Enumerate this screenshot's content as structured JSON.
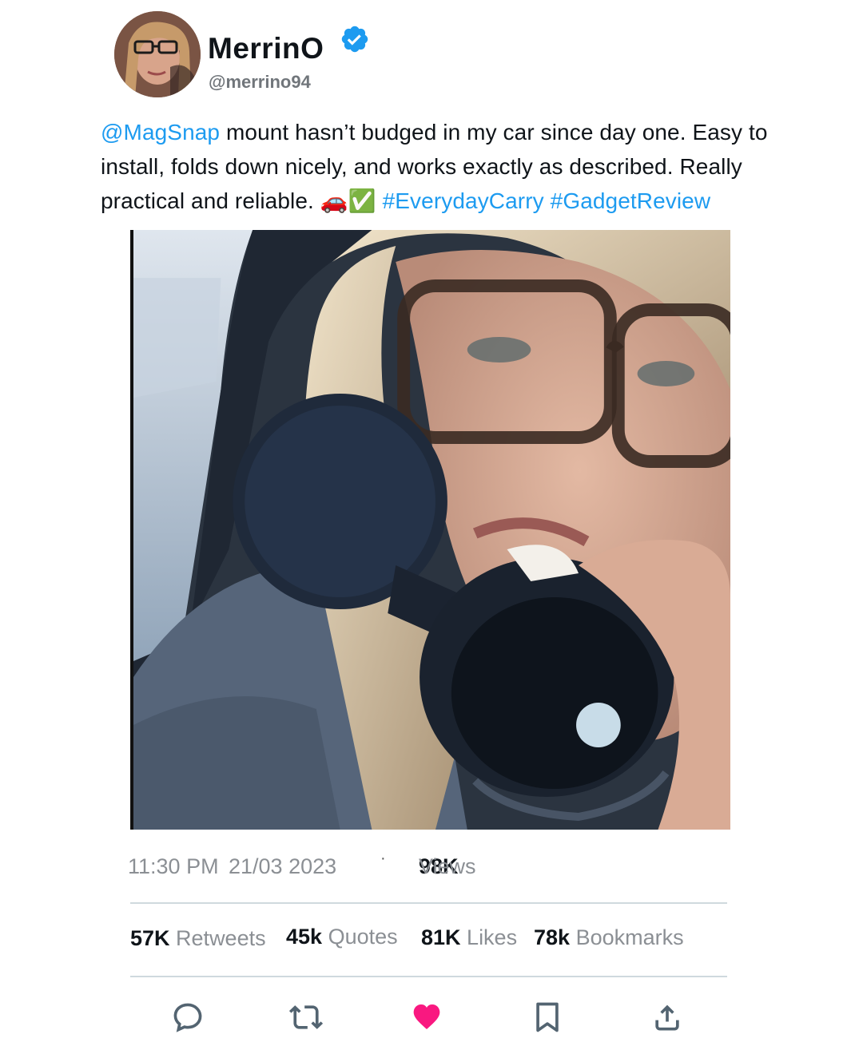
{
  "author": {
    "display_name": "MerrinO",
    "handle": "@merrino94",
    "verified": true
  },
  "tweet": {
    "mention": "@MagSnap",
    "text_main": " mount hasn’t budged in my car since day one. Easy to install, folds down nicely, and works exactly as described. Really practical and reliable. ",
    "emojis": "🚗✅",
    "hashtag_1": "#EverydayCarry",
    "hashtag_2": "#GadgetReview"
  },
  "meta": {
    "time": "11:30 PM",
    "date": "21/03 2023",
    "separator": "·",
    "views_count": "98K",
    "views_label": "Views"
  },
  "stats": {
    "retweets_count": "57K",
    "retweets_label": "Retweets",
    "quotes_count": "45k",
    "quotes_label": "Quotes",
    "likes_count": "81K",
    "likes_label": "Likes",
    "bookmarks_count": "78k",
    "bookmarks_label": "Bookmarks"
  },
  "actions": {
    "reply_icon": "speech-bubble",
    "retweet_icon": "retweet-arrows",
    "like_icon": "heart-filled",
    "bookmark_icon": "bookmark",
    "share_icon": "share-upload"
  },
  "colors": {
    "link": "#1d9bf0",
    "verified": "#1d9bf0",
    "like": "#f91880",
    "muted_text": "#8b8f94"
  }
}
